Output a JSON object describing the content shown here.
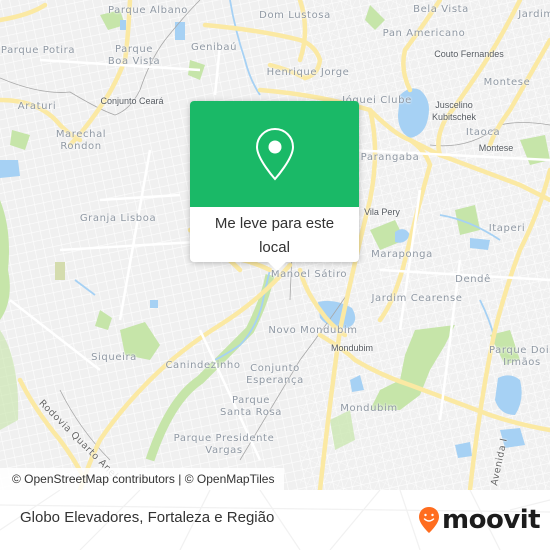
{
  "map": {
    "places": [
      {
        "name": "Parque Albano",
        "type": "district"
      },
      {
        "name": "Dom Lustosa",
        "type": "district"
      },
      {
        "name": "Bela Vista",
        "type": "district"
      },
      {
        "name": "Jardim",
        "type": "district"
      },
      {
        "name": "Parque Potira",
        "type": "district"
      },
      {
        "name": "Parque\nBoa Vista",
        "type": "district"
      },
      {
        "name": "Genibaú",
        "type": "district"
      },
      {
        "name": "Pan Americano",
        "type": "district"
      },
      {
        "name": "Couto Fernandes",
        "type": "locality"
      },
      {
        "name": "Henrique Jorge",
        "type": "district"
      },
      {
        "name": "Montese",
        "type": "district"
      },
      {
        "name": "Araturi",
        "type": "district"
      },
      {
        "name": "Conjunto Ceará",
        "type": "locality"
      },
      {
        "name": "Jóquei Clube",
        "type": "district"
      },
      {
        "name": "Juscelino\nKubitschek",
        "type": "locality"
      },
      {
        "name": "Marechal\nRondon",
        "type": "district"
      },
      {
        "name": "Itaoca",
        "type": "district"
      },
      {
        "name": "Montese",
        "type": "locality"
      },
      {
        "name": "Parangaba",
        "type": "district"
      },
      {
        "name": "Granja Lisboa",
        "type": "district"
      },
      {
        "name": "Vila Pery",
        "type": "locality"
      },
      {
        "name": "Itaperi",
        "type": "district"
      },
      {
        "name": "Maraponga",
        "type": "district"
      },
      {
        "name": "Manoel Sátiro",
        "type": "district"
      },
      {
        "name": "Dendê",
        "type": "district"
      },
      {
        "name": "Jardim Cearense",
        "type": "district"
      },
      {
        "name": "Novo Mondubim",
        "type": "district"
      },
      {
        "name": "Mondubim",
        "type": "locality"
      },
      {
        "name": "Parque Dois\nIrmãos",
        "type": "district"
      },
      {
        "name": "Siqueira",
        "type": "district"
      },
      {
        "name": "Canindezinho",
        "type": "district"
      },
      {
        "name": "Conjunto\nEsperança",
        "type": "district"
      },
      {
        "name": "Parque\nSanta Rosa",
        "type": "district"
      },
      {
        "name": "Mondubim",
        "type": "district"
      },
      {
        "name": "Parque Presidente\nVargas",
        "type": "district"
      },
      {
        "name": "Rodovia Quarto Anel",
        "type": "road"
      },
      {
        "name": "Avenida I",
        "type": "road"
      }
    ],
    "colors": {
      "background": "#f2f2f2",
      "road_major": "#fbe9a3",
      "road_minor": "#ffffff",
      "water": "#a6d1f4",
      "park": "#c6e5a9",
      "label": "#8f98a3"
    }
  },
  "popup": {
    "icon": "map-pin-icon",
    "label": "Me leve para este local",
    "color": "#1ab967"
  },
  "attribution": {
    "osm": "© OpenStreetMap contributors",
    "separator": " | ",
    "omt": "© OpenMapTiles"
  },
  "footer": {
    "title": "Globo Elevadores, Fortaleza e Região",
    "logo_text": "moovit",
    "logo_color": "#ff6d1f"
  }
}
